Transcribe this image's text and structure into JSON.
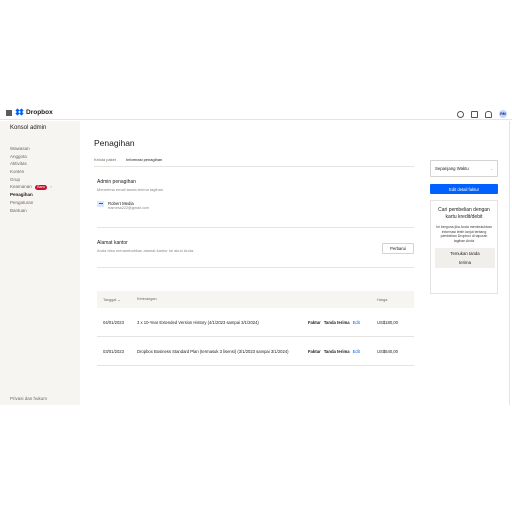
{
  "app": {
    "logo_text": "Dropbox",
    "avatar_initials": "RM"
  },
  "topbar": {
    "icons": [
      "help-icon",
      "gift-icon",
      "bell-icon"
    ]
  },
  "sidebar": {
    "title": "Konsol admin",
    "items": [
      {
        "label": "Wawasan"
      },
      {
        "label": "Anggota"
      },
      {
        "label": "Aktivitas"
      },
      {
        "label": "Konten"
      },
      {
        "label": "Grup"
      },
      {
        "label": "Keamanan",
        "badge": "Baru"
      },
      {
        "label": "Penagihan",
        "active": true
      },
      {
        "label": "Pengaturan"
      },
      {
        "label": "Bantuan"
      }
    ],
    "footer": "Privasi dan hukum"
  },
  "main": {
    "title": "Penagihan",
    "tabs": [
      {
        "label": "Kelola paket"
      },
      {
        "label": "Informasi penagihan",
        "active": true
      }
    ],
    "admin_section": {
      "title": "Admin penagihan",
      "subtitle": "Menerima email tanda terima tagihan",
      "name": "Robert Media",
      "email": "rtamesa222@gmail.com"
    },
    "office_section": {
      "title": "Alamat kantor",
      "subtitle": "Anda bisa menambahkan alamat kantor ke akun Anda.",
      "button": "Perbarui"
    },
    "table": {
      "headers": {
        "date": "Tanggal ⌄",
        "desc": "Keterangan",
        "price": "Harga"
      },
      "rows": [
        {
          "date": "04/01/2023",
          "desc": "3 x 10-Year Extended Version History (4/1/2023 sampai 3/1/2024)",
          "invoice": "Faktur",
          "receipt": "Tanda terima",
          "edit": "Edit",
          "price": "US$180,00"
        },
        {
          "date": "03/01/2023",
          "desc": "Dropbox Business Standard Plan (termasuk 3 lisensi) (3/1/2023 sampai 3/1/2024)",
          "invoice": "Faktur",
          "receipt": "Tanda terima",
          "edit": "Edit",
          "price": "US$540,00"
        }
      ]
    }
  },
  "right_panel": {
    "select_value": "Sepanjang Waktu",
    "edit_button": "Edit detail faktur",
    "card_title": "Cari pembelian dengan kartu kredit/debit",
    "card_body": "Ini berguna jika Anda membutuhkan informasi lebih lanjut tentang pembelian Dropbox di laporan tagihan Anda",
    "card_button_line1": "Temukan tanda",
    "card_button_line2": "terima"
  },
  "colors": {
    "accent": "#0061fe",
    "badge": "#c8102e",
    "sidebar_bg": "#f7f5f2"
  }
}
